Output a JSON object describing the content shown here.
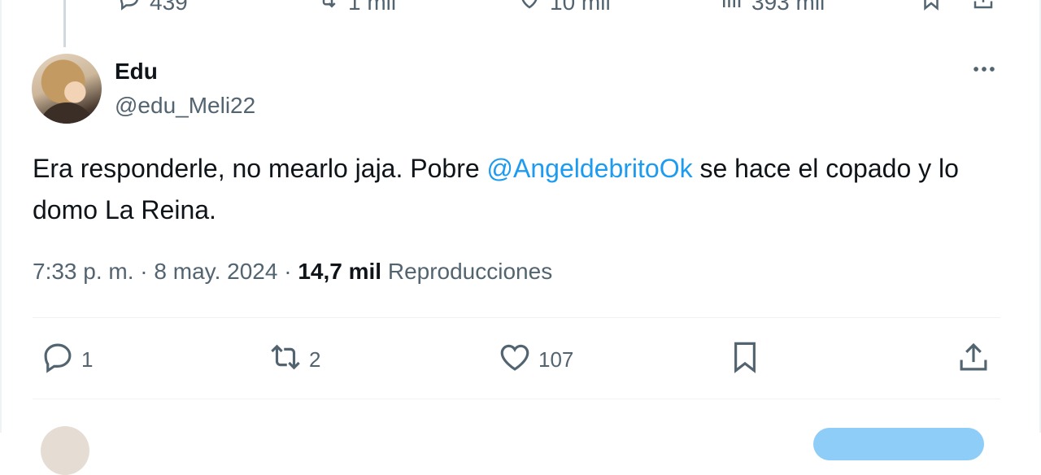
{
  "previous_tweet": {
    "actions": {
      "replies": "439",
      "retweets": "1 mil",
      "likes": "10 mil",
      "views": "393 mil"
    }
  },
  "tweet": {
    "author_name": "Edu",
    "author_handle": "@edu_Meli22",
    "text_before": "Era responderle, no mearlo jaja. Pobre ",
    "mention": "@AngeldebritoOk",
    "text_after": " se hace el copado y lo domo La Reina.",
    "time": "7:33 p. m.",
    "separator": "·",
    "date": "8 may. 2024",
    "views_count": "14,7 mil",
    "views_label": "Reproducciones",
    "actions": {
      "replies": "1",
      "retweets": "2",
      "likes": "107"
    }
  },
  "colors": {
    "text": "#0f1419",
    "secondary": "#536471",
    "link": "#1d9bf0",
    "divider": "#eff3f4"
  },
  "icons": [
    "reply-icon",
    "retweet-icon",
    "like-icon",
    "views-icon",
    "bookmark-icon",
    "share-icon",
    "more-icon"
  ]
}
